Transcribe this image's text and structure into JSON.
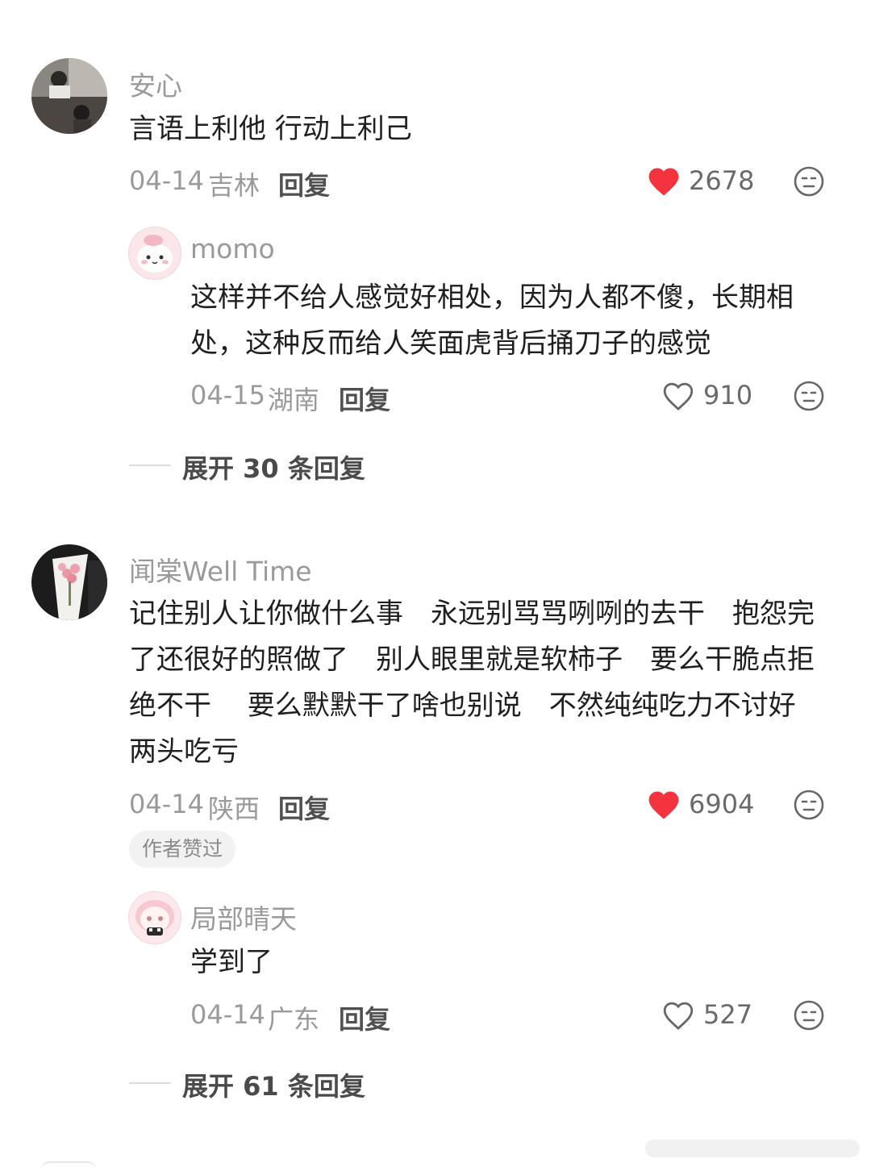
{
  "comments": [
    {
      "username": "安心",
      "content": "言语上利他 行动上利己",
      "date": "04-14",
      "location": "吉林",
      "reply_label": "回复",
      "likes": "2678",
      "liked": true,
      "replies": [
        {
          "username": "momo",
          "content": "这样并不给人感觉好相处，因为人都不傻，长期相处，这种反而给人笑面虎背后捅刀子的感觉",
          "date": "04-15",
          "location": "湖南",
          "reply_label": "回复",
          "likes": "910",
          "liked": false
        }
      ],
      "expand_label": "展开 30 条回复"
    },
    {
      "username": "闻棠Well Time",
      "content": "记住别人让你做什么事　永远别骂骂咧咧的去干　抱怨完了还很好的照做了　别人眼里就是软柿子　要么干脆点拒绝不干　 要么默默干了啥也别说　不然纯纯吃力不讨好　两头吃亏",
      "date": "04-14",
      "location": "陕西",
      "reply_label": "回复",
      "likes": "6904",
      "liked": true,
      "badge": "作者赞过",
      "replies": [
        {
          "username": "局部晴天",
          "content": "学到了",
          "date": "04-14",
          "location": "广东",
          "reply_label": "回复",
          "likes": "527",
          "liked": false
        }
      ],
      "expand_label": "展开 61 条回复"
    }
  ],
  "icons": {
    "like_filled": "heart-filled-icon",
    "like_outline": "heart-outline-icon",
    "dislike": "unimpressed-face-icon"
  },
  "colors": {
    "like_active": "#f5333f",
    "text_primary": "#1f1f1f",
    "text_secondary": "#9a9a9a"
  }
}
